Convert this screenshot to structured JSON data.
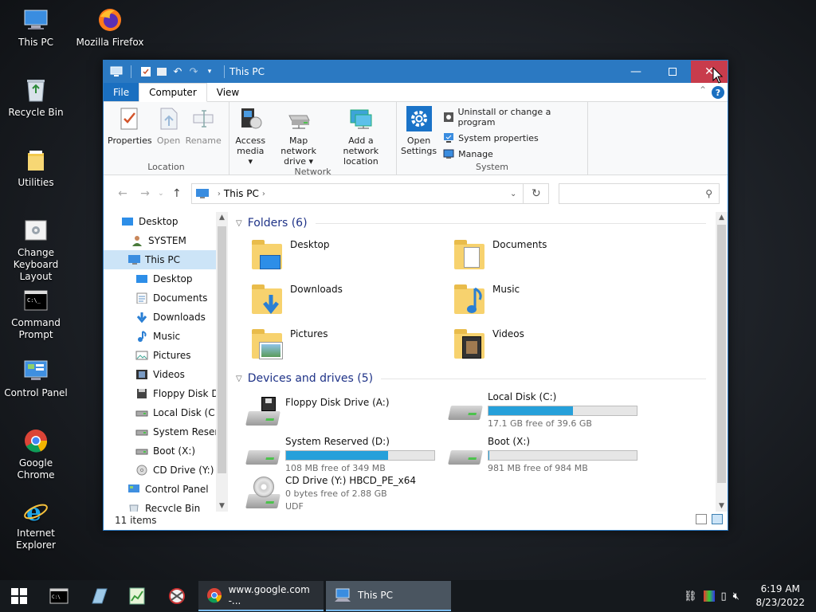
{
  "desktop": {
    "icons": [
      {
        "label": "This PC"
      },
      {
        "label": "Mozilla Firefox"
      },
      {
        "label": "Recycle Bin"
      },
      {
        "label": "Utilities"
      },
      {
        "label": "Change Keyboard Layout"
      },
      {
        "label": "Command Prompt"
      },
      {
        "label": "Control Panel"
      },
      {
        "label": "Google Chrome"
      },
      {
        "label": "Internet Explorer"
      }
    ]
  },
  "window": {
    "title": "This PC",
    "tabs": {
      "file": "File",
      "computer": "Computer",
      "view": "View"
    },
    "ribbon": {
      "location": {
        "name": "Location",
        "properties": "Properties",
        "open": "Open",
        "rename": "Rename"
      },
      "network": {
        "name": "Network",
        "access_media_1": "Access",
        "access_media_2": "media ▾",
        "map_drive_1": "Map network",
        "map_drive_2": "drive ▾",
        "add_location_1": "Add a network",
        "add_location_2": "location"
      },
      "system": {
        "name": "System",
        "open_settings_1": "Open",
        "open_settings_2": "Settings",
        "uninstall": "Uninstall or change a program",
        "system_properties": "System properties",
        "manage": "Manage"
      }
    },
    "address": {
      "path": "This PC"
    },
    "nav_items": [
      {
        "label": "Desktop"
      },
      {
        "label": "SYSTEM"
      },
      {
        "label": "This PC"
      },
      {
        "label": "Desktop"
      },
      {
        "label": "Documents"
      },
      {
        "label": "Downloads"
      },
      {
        "label": "Music"
      },
      {
        "label": "Pictures"
      },
      {
        "label": "Videos"
      },
      {
        "label": "Floppy Disk Dri"
      },
      {
        "label": "Local Disk (C:)"
      },
      {
        "label": "System Reserve"
      },
      {
        "label": "Boot (X:)"
      },
      {
        "label": "CD Drive (Y:) H"
      },
      {
        "label": "Control Panel"
      },
      {
        "label": "Recycle Bin"
      }
    ],
    "folders_header": "Folders (6)",
    "folders": [
      {
        "label": "Desktop"
      },
      {
        "label": "Documents"
      },
      {
        "label": "Downloads"
      },
      {
        "label": "Music"
      },
      {
        "label": "Pictures"
      },
      {
        "label": "Videos"
      }
    ],
    "devices_header": "Devices and drives (5)",
    "drives": [
      {
        "label": "Floppy Disk Drive (A:)"
      },
      {
        "label": "Local Disk (C:)",
        "free": "17.1 GB free of 39.6 GB",
        "used_fraction": 0.568
      },
      {
        "label": "System Reserved (D:)",
        "free": "108 MB free of 349 MB",
        "used_fraction": 0.69
      },
      {
        "label": "Boot (X:)",
        "free": "981 MB free of 984 MB",
        "used_fraction": 0.003
      },
      {
        "label": "CD Drive (Y:) HBCD_PE_x64",
        "free": "0 bytes free of 2.88 GB",
        "extra": "UDF"
      }
    ],
    "status": "11 items"
  },
  "taskbar": {
    "tasks": [
      {
        "label": "www.google.com -..."
      },
      {
        "label": "This PC"
      }
    ],
    "time": "6:19 AM",
    "date": "8/23/2022"
  },
  "colors": {
    "accent": "#2b79c2",
    "bar_fill": "#26a0da",
    "close_hover": "#c83c4c"
  }
}
